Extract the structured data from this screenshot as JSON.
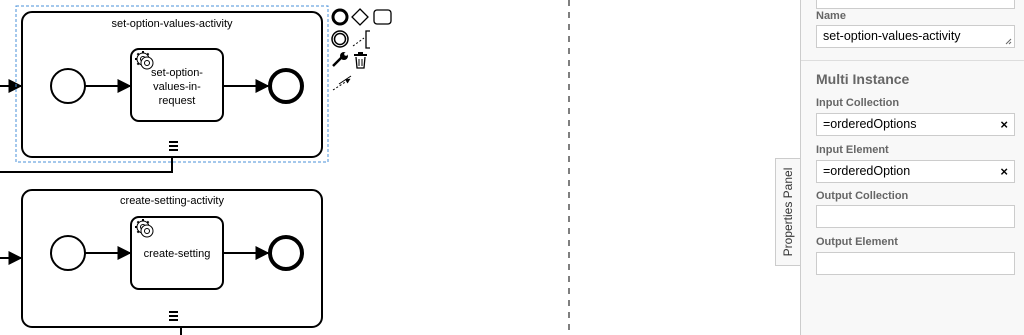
{
  "diagram": {
    "subprocess_1": {
      "label": "set-option-values-activity",
      "task_label_lines": [
        "set-option-",
        "values-in-",
        "request"
      ]
    },
    "subprocess_2": {
      "label": "create-setting-activity",
      "task_label_lines": [
        "create-setting"
      ]
    }
  },
  "context_pad": {
    "items": [
      "end-event-icon",
      "gateway-icon",
      "task-icon",
      "intermediate-event-icon",
      "text-annotation-icon",
      "wrench-icon",
      "trash-icon",
      "connect-icon"
    ]
  },
  "properties_panel": {
    "toggle_label": "Properties Panel",
    "name_label": "Name",
    "name_value": "set-option-values-activity",
    "section_title": "Multi Instance",
    "input_collection_label": "Input Collection",
    "input_collection_value": "=orderedOptions",
    "input_element_label": "Input Element",
    "input_element_value": "=orderedOption",
    "output_collection_label": "Output Collection",
    "output_collection_value": "",
    "output_element_label": "Output Element",
    "output_element_value": "",
    "clear_glyph": "×"
  },
  "colors": {
    "selection": "#4a90d9",
    "panel_bg": "#f8f8f8",
    "label_gray": "#666666"
  }
}
